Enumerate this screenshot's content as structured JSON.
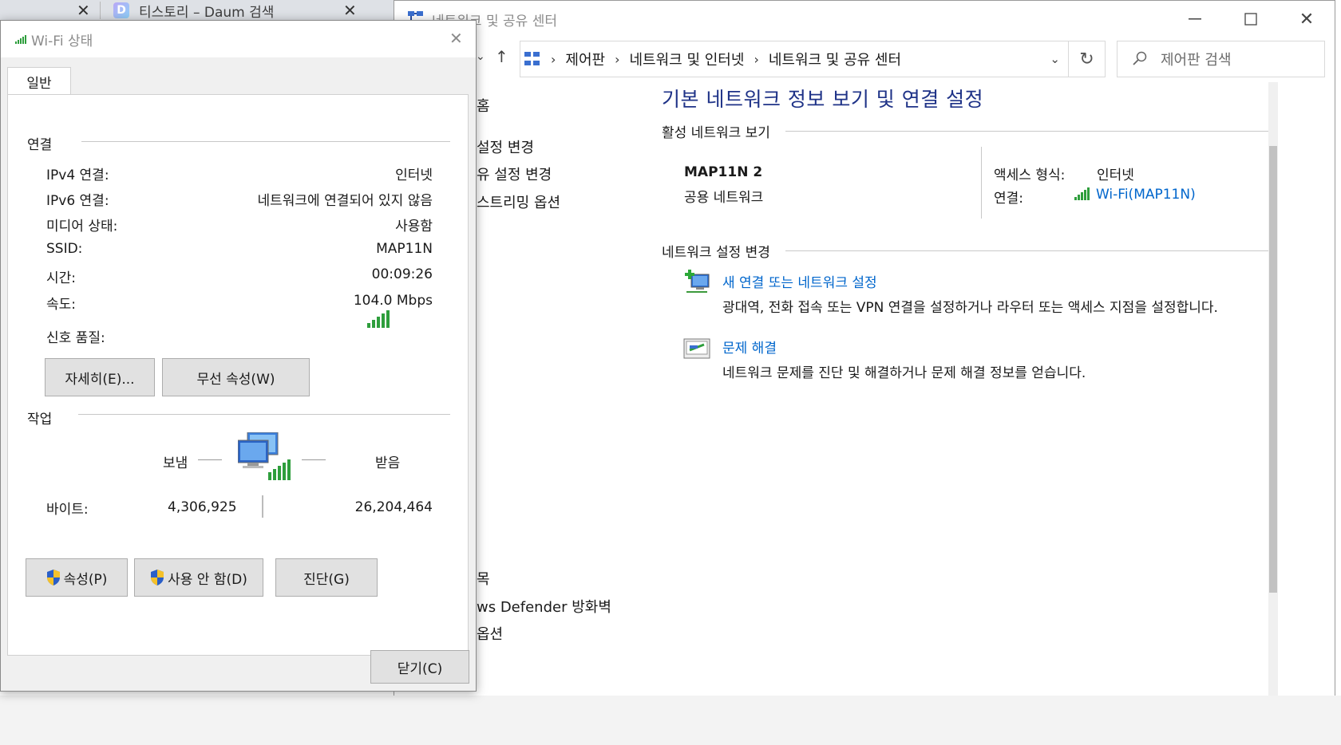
{
  "browser_tabs": {
    "tab2_title": "티스토리 – Daum 검색"
  },
  "control_panel": {
    "window_title": "네트워크 및 공유 센터",
    "breadcrumb": [
      "제어판",
      "네트워크 및 인터넷",
      "네트워크 및 공유 센터"
    ],
    "search_placeholder": "제어판 검색",
    "left_links_top": [
      "홈",
      "설정 변경",
      "유 설정 변경",
      "스트리밍 옵션"
    ],
    "left_links_bottom": [
      "목",
      "ws Defender 방화벽",
      "옵션"
    ],
    "heading": "기본 네트워크 정보 보기 및 연결 설정",
    "active_networks_header": "활성 네트워크 보기",
    "network": {
      "name": "MAP11N 2",
      "type": "공용 네트워크",
      "access_label": "액세스 형식:",
      "access_value": "인터넷",
      "connection_label": "연결:",
      "connection_value": "Wi-Fi(MAP11N)"
    },
    "change_settings_header": "네트워크 설정 변경",
    "tasks": [
      {
        "title": "새 연결 또는 네트워크 설정",
        "desc": "광대역, 전화 접속 또는 VPN 연결을 설정하거나 라우터 또는 액세스 지점을 설정합니다."
      },
      {
        "title": "문제 해결",
        "desc": "네트워크 문제를 진단 및 해결하거나 문제 해결 정보를 얻습니다."
      }
    ]
  },
  "wifi_dialog": {
    "title": "Wi-Fi 상태",
    "tab_general": "일반",
    "connection_group": "연결",
    "rows": [
      {
        "label": "IPv4 연결:",
        "value": "인터넷"
      },
      {
        "label": "IPv6 연결:",
        "value": "네트워크에 연결되어 있지 않음"
      },
      {
        "label": "미디어 상태:",
        "value": "사용함"
      },
      {
        "label": "SSID:",
        "value": "MAP11N"
      },
      {
        "label": "시간:",
        "value": "00:09:26"
      },
      {
        "label": "속도:",
        "value": "104.0 Mbps"
      }
    ],
    "signal_label": "신호 품질:",
    "signal_bars_lit": 5,
    "signal_bars_total": 5,
    "details_button": "자세히(E)...",
    "wireless_props_button": "무선 속성(W)",
    "activity_group": "작업",
    "sent_label": "보냄",
    "received_label": "받음",
    "bytes_label": "바이트:",
    "bytes_sent": "4,306,925",
    "bytes_received": "26,204,464",
    "properties_button": "속성(P)",
    "disable_button": "사용 안 함(D)",
    "diagnose_button": "진단(G)",
    "close_button": "닫기(C)"
  },
  "colors": {
    "heading_blue": "#1e3287",
    "link_blue": "#0066cc",
    "signal_green": "#2e9e3c"
  }
}
